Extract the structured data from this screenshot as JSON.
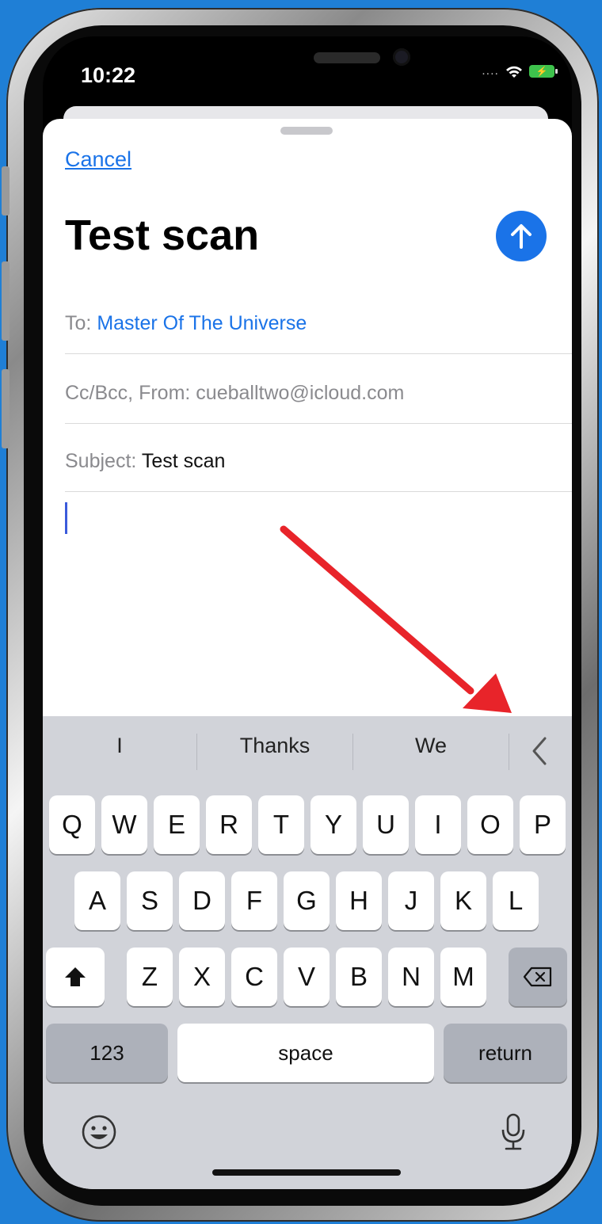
{
  "status_bar": {
    "time": "10:22",
    "signal": "....",
    "wifi_icon": "wifi-icon",
    "battery_icon": "battery-charging-icon"
  },
  "compose": {
    "cancel": "Cancel",
    "title": "Test scan",
    "send_icon": "arrow-up-icon",
    "to_label": "To:",
    "to_value": "Master Of The Universe",
    "ccbcc_label": "Cc/Bcc, From:",
    "from_value": "cueballtwo@icloud.com",
    "subject_label": "Subject:",
    "subject_value": "Test scan"
  },
  "keyboard": {
    "suggestions": [
      "I",
      "Thanks",
      "We"
    ],
    "row1": [
      "Q",
      "W",
      "E",
      "R",
      "T",
      "Y",
      "U",
      "I",
      "O",
      "P"
    ],
    "row2": [
      "A",
      "S",
      "D",
      "F",
      "G",
      "H",
      "J",
      "K",
      "L"
    ],
    "row3": [
      "Z",
      "X",
      "C",
      "V",
      "B",
      "N",
      "M"
    ],
    "numbers": "123",
    "space": "space",
    "return": "return"
  },
  "colors": {
    "background": "#1f7fd6",
    "accent": "#1a73e8",
    "arrow": "#e8242a"
  }
}
